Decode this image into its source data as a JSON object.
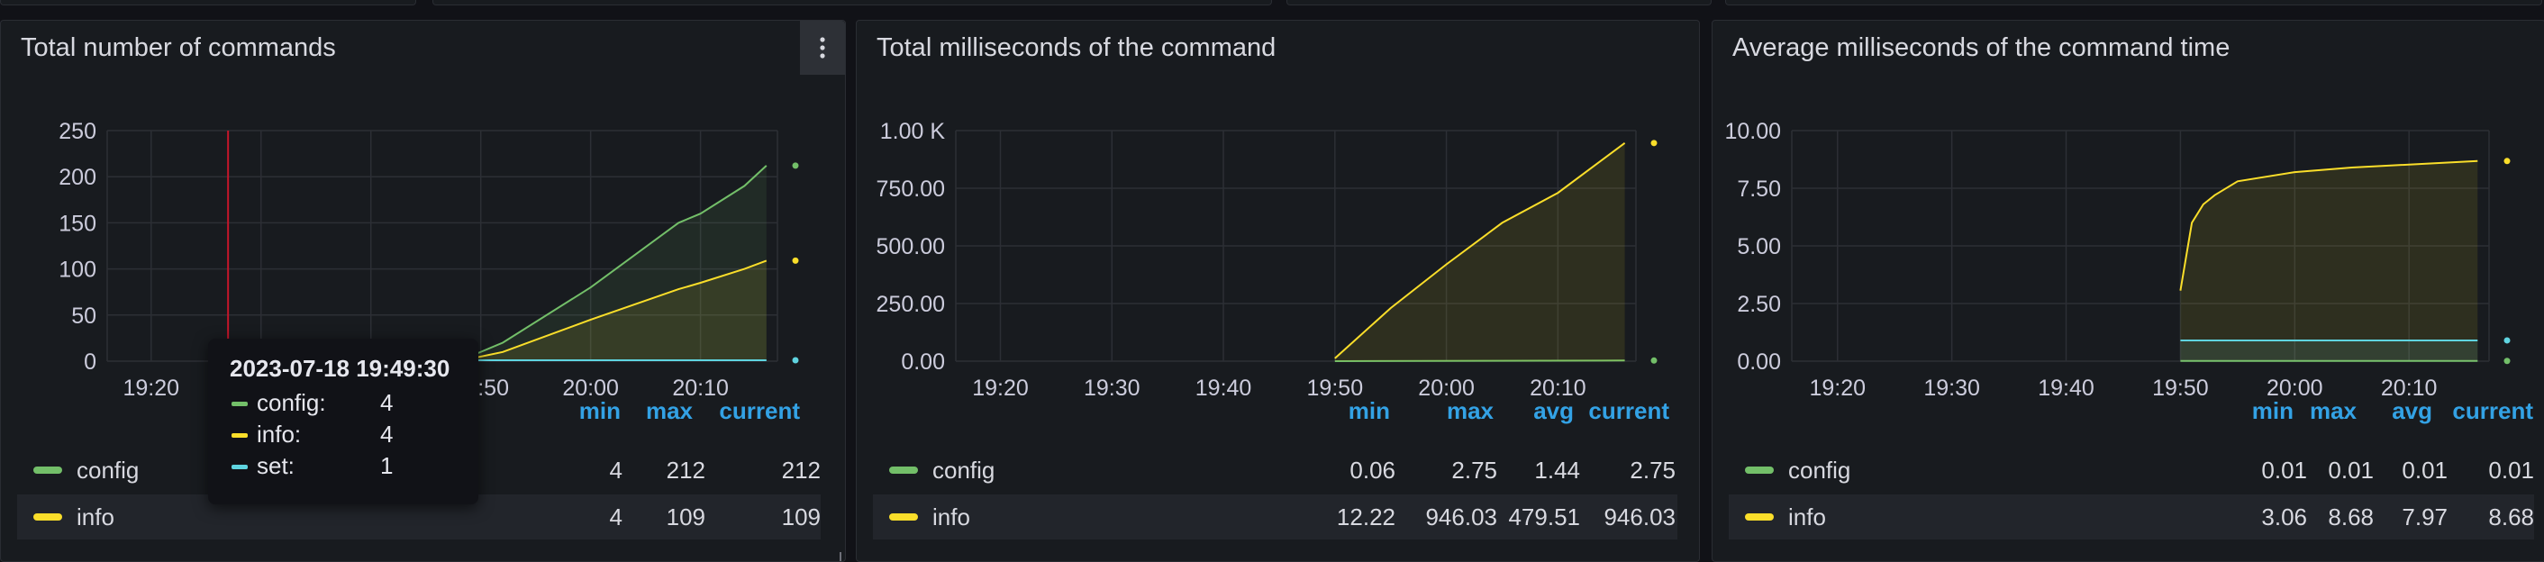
{
  "colors": {
    "config": "#73bf69",
    "info": "#fade2a",
    "set": "#5fd4e0",
    "accent": "#33a2e5",
    "annotation": "#c4162a"
  },
  "panels": [
    {
      "title": "Total number of commands",
      "chart_data": {
        "type": "line",
        "title": "Total number of commands",
        "x_ticks": [
          "19:20",
          "19:30",
          "19:40",
          "19:50",
          "20:00",
          "20:10"
        ],
        "y_ticks": [
          "250",
          "200",
          "150",
          "100",
          "50",
          "0"
        ],
        "ylim": [
          0,
          250
        ],
        "grid": true,
        "annotation_time": "19:27",
        "series": [
          {
            "name": "config",
            "x": [
              "19:48",
              "19:52",
              "20:00",
              "20:08",
              "20:10",
              "20:14",
              "20:16"
            ],
            "y": [
              0,
              20,
              80,
              150,
              160,
              190,
              212
            ]
          },
          {
            "name": "info",
            "x": [
              "19:48",
              "19:52",
              "20:00",
              "20:08",
              "20:10",
              "20:14",
              "20:16"
            ],
            "y": [
              0,
              10,
              45,
              78,
              85,
              100,
              109
            ]
          },
          {
            "name": "set",
            "x": [
              "19:48",
              "20:16"
            ],
            "y": [
              1,
              1
            ]
          }
        ]
      },
      "legend": {
        "headers": [
          "min",
          "max",
          "current"
        ],
        "rows": [
          {
            "name": "config",
            "values": [
              "4",
              "212",
              "212"
            ]
          },
          {
            "name": "info",
            "values": [
              "4",
              "109",
              "109"
            ]
          }
        ]
      },
      "tooltip": {
        "time": "2023-07-18 19:49:30",
        "rows": [
          {
            "label": "config:",
            "value": "4"
          },
          {
            "label": "info:",
            "value": "4"
          },
          {
            "label": "set:",
            "value": "1"
          }
        ]
      }
    },
    {
      "title": "Total milliseconds of the command",
      "chart_data": {
        "type": "line",
        "title": "Total milliseconds of the command",
        "x_ticks": [
          "19:20",
          "19:30",
          "19:40",
          "19:50",
          "20:00",
          "20:10"
        ],
        "y_ticks": [
          "1.00 K",
          "750.00",
          "500.00",
          "250.00",
          "0.00"
        ],
        "ylim": [
          0,
          1000
        ],
        "grid": true,
        "series": [
          {
            "name": "config",
            "x": [
              "19:50",
              "20:16"
            ],
            "y": [
              0.06,
              2.75
            ]
          },
          {
            "name": "info",
            "x": [
              "19:50",
              "19:55",
              "20:00",
              "20:05",
              "20:10",
              "20:16"
            ],
            "y": [
              12,
              230,
              420,
              600,
              730,
              946
            ]
          }
        ]
      },
      "legend": {
        "headers": [
          "min",
          "max",
          "avg",
          "current"
        ],
        "rows": [
          {
            "name": "config",
            "values": [
              "0.06",
              "2.75",
              "1.44",
              "2.75"
            ]
          },
          {
            "name": "info",
            "values": [
              "12.22",
              "946.03",
              "479.51",
              "946.03"
            ]
          }
        ]
      }
    },
    {
      "title": "Average milliseconds of the command time",
      "chart_data": {
        "type": "line",
        "title": "Average milliseconds of the command time",
        "x_ticks": [
          "19:20",
          "19:30",
          "19:40",
          "19:50",
          "20:00",
          "20:10"
        ],
        "y_ticks": [
          "10.00",
          "7.50",
          "5.00",
          "2.50",
          "0.00"
        ],
        "ylim": [
          0,
          10
        ],
        "grid": true,
        "series": [
          {
            "name": "config",
            "x": [
              "19:50",
              "20:16"
            ],
            "y": [
              0.01,
              0.01
            ]
          },
          {
            "name": "info",
            "x": [
              "19:50",
              "19:51",
              "19:52",
              "19:53",
              "19:55",
              "20:00",
              "20:05",
              "20:16"
            ],
            "y": [
              3.06,
              6.0,
              6.8,
              7.2,
              7.8,
              8.2,
              8.4,
              8.68
            ]
          },
          {
            "name": "set",
            "x": [
              "19:50",
              "20:16"
            ],
            "y": [
              0.9,
              0.9
            ]
          }
        ]
      },
      "legend": {
        "headers": [
          "min",
          "max",
          "avg",
          "current"
        ],
        "rows": [
          {
            "name": "config",
            "values": [
              "0.01",
              "0.01",
              "0.01",
              "0.01"
            ]
          },
          {
            "name": "info",
            "values": [
              "3.06",
              "8.68",
              "7.97",
              "8.68"
            ]
          }
        ]
      }
    }
  ]
}
